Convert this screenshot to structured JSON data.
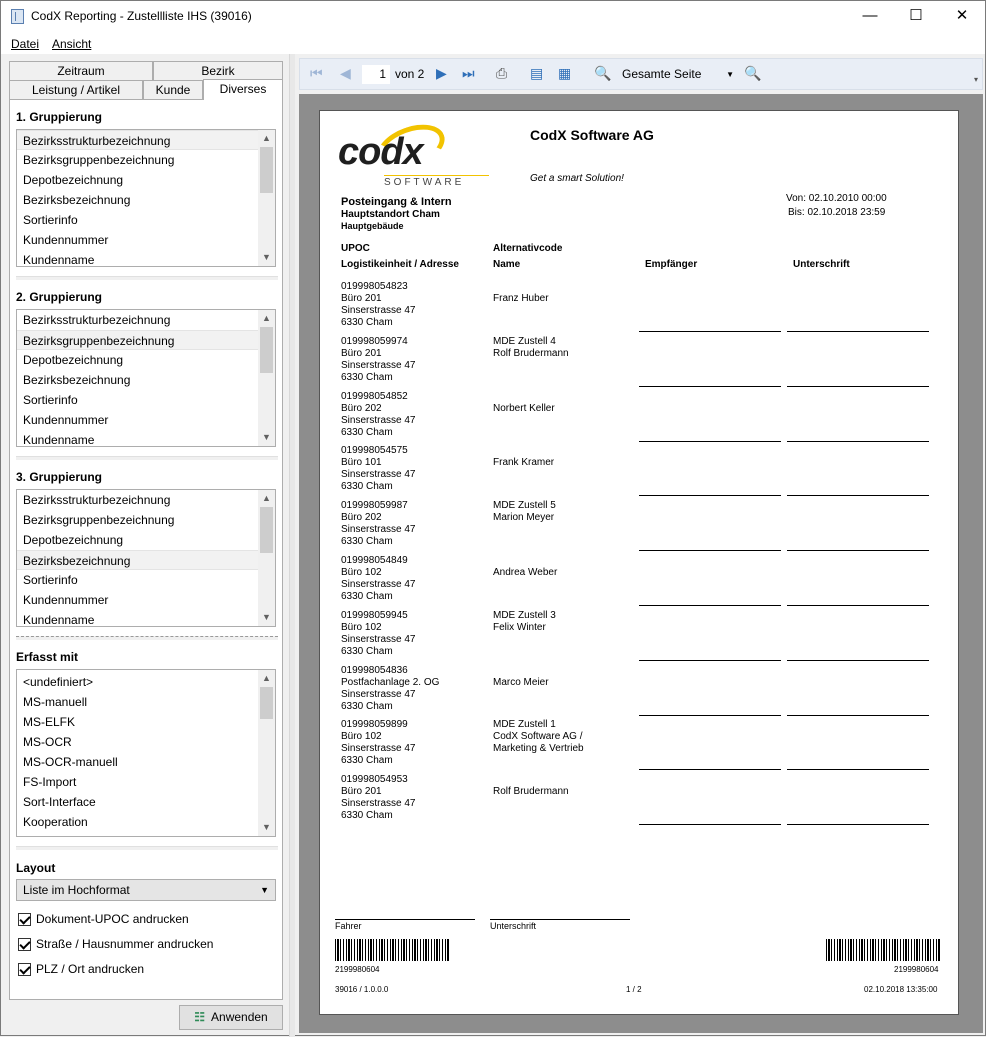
{
  "window": {
    "title": "CodX Reporting - Zustellliste IHS (39016)",
    "minimize": "—",
    "maximize": "☐",
    "close": "✕"
  },
  "menu": {
    "datei": "Datei",
    "ansicht": "Ansicht"
  },
  "tabs": {
    "zeitraum": "Zeitraum",
    "bezirk": "Bezirk",
    "leistung": "Leistung / Artikel",
    "kunde": "Kunde",
    "diverses": "Diverses"
  },
  "group1": {
    "title": "1. Gruppierung",
    "items": [
      "Bezirksstrukturbezeichnung",
      "Bezirksgruppenbezeichnung",
      "Depotbezeichnung",
      "Bezirksbezeichnung",
      "Sortierinfo",
      "Kundennummer",
      "Kundenname"
    ],
    "selected": "Bezirksstrukturbezeichnung"
  },
  "group2": {
    "title": "2. Gruppierung",
    "items": [
      "Bezirksstrukturbezeichnung",
      "Bezirksgruppenbezeichnung",
      "Depotbezeichnung",
      "Bezirksbezeichnung",
      "Sortierinfo",
      "Kundennummer",
      "Kundenname"
    ],
    "selected": "Bezirksgruppenbezeichnung"
  },
  "group3": {
    "title": "3. Gruppierung",
    "items": [
      "Bezirksstrukturbezeichnung",
      "Bezirksgruppenbezeichnung",
      "Depotbezeichnung",
      "Bezirksbezeichnung",
      "Sortierinfo",
      "Kundennummer",
      "Kundenname"
    ],
    "selected": "Bezirksbezeichnung"
  },
  "erfasst": {
    "title": "Erfasst mit",
    "items": [
      "<undefiniert>",
      "MS-manuell",
      "MS-ELFK",
      "MS-OCR",
      "MS-OCR-manuell",
      "FS-Import",
      "Sort-Interface",
      "Kooperation"
    ]
  },
  "layout": {
    "title": "Layout",
    "value": "Liste im Hochformat",
    "checks": [
      "Dokument-UPOC andrucken",
      "Straße / Hausnummer andrucken",
      "PLZ / Ort andrucken"
    ]
  },
  "apply": "Anwenden",
  "toolbar": {
    "page": "1",
    "of": "von 2",
    "zoom": "Gesamte Seite"
  },
  "report": {
    "company": "CodX Software AG",
    "slogan": "Get a smart Solution!",
    "logo_text": "codx",
    "logo_sub": "SOFTWARE",
    "dept": "Posteingang & Intern",
    "site": "Hauptstandort Cham",
    "building": "Hauptgebäude",
    "from": "Von: 02.10.2010 00:00",
    "to": "Bis:  02.10.2018 23:59",
    "col_upoc": "UPOC",
    "col_alt": "Alternativcode",
    "col_loc": "Logistikeinheit / Adresse",
    "col_name": "Name",
    "col_recv": "Empfänger",
    "col_sign": "Unterschrift",
    "rows": [
      {
        "code": "019998054823",
        "addr": [
          "Büro 201",
          "Sinserstrasse 47",
          "6330 Cham"
        ],
        "name": [
          "Franz Huber"
        ]
      },
      {
        "code": "019998059974",
        "addr": [
          "Büro 201",
          "Sinserstrasse 47",
          "6330 Cham"
        ],
        "name": [
          "MDE  Zustell 4",
          "Rolf Brudermann"
        ]
      },
      {
        "code": "019998054852",
        "addr": [
          "Büro 202",
          "Sinserstrasse 47",
          "6330 Cham"
        ],
        "name": [
          "Norbert Keller"
        ]
      },
      {
        "code": "019998054575",
        "addr": [
          "Büro 101",
          "Sinserstrasse 47",
          "6330 Cham"
        ],
        "name": [
          "Frank Kramer"
        ]
      },
      {
        "code": "019998059987",
        "addr": [
          "Büro 202",
          "Sinserstrasse 47",
          "6330 Cham"
        ],
        "name": [
          "MDE  Zustell 5",
          "Marion Meyer"
        ]
      },
      {
        "code": "019998054849",
        "addr": [
          "Büro 102",
          "Sinserstrasse 47",
          "6330 Cham"
        ],
        "name": [
          "Andrea Weber"
        ]
      },
      {
        "code": "019998059945",
        "addr": [
          "Büro 102",
          "Sinserstrasse 47",
          "6330 Cham"
        ],
        "name": [
          "MDE  Zustell 3",
          "Felix Winter"
        ]
      },
      {
        "code": "019998054836",
        "addr": [
          "Postfachanlage 2. OG",
          "Sinserstrasse 47",
          "6330 Cham"
        ],
        "name": [
          "Marco Meier"
        ]
      },
      {
        "code": "019998059899",
        "addr": [
          "Büro 102",
          "Sinserstrasse 47",
          "6330 Cham"
        ],
        "name": [
          "MDE  Zustell 1",
          "CodX Software AG   /",
          "Marketing & Vertrieb"
        ]
      },
      {
        "code": "019998054953",
        "addr": [
          "Büro 201",
          "Sinserstrasse 47",
          "6330 Cham"
        ],
        "name": [
          "Rolf Brudermann"
        ]
      }
    ],
    "footer_driver": "Fahrer",
    "footer_sign": "Unterschrift",
    "barcode_left": "2199980604",
    "barcode_right": "2199980604",
    "doc_id": "39016 / 1.0.0.0",
    "page": "1 / 2",
    "printed": "02.10.2018 13:35:00"
  }
}
